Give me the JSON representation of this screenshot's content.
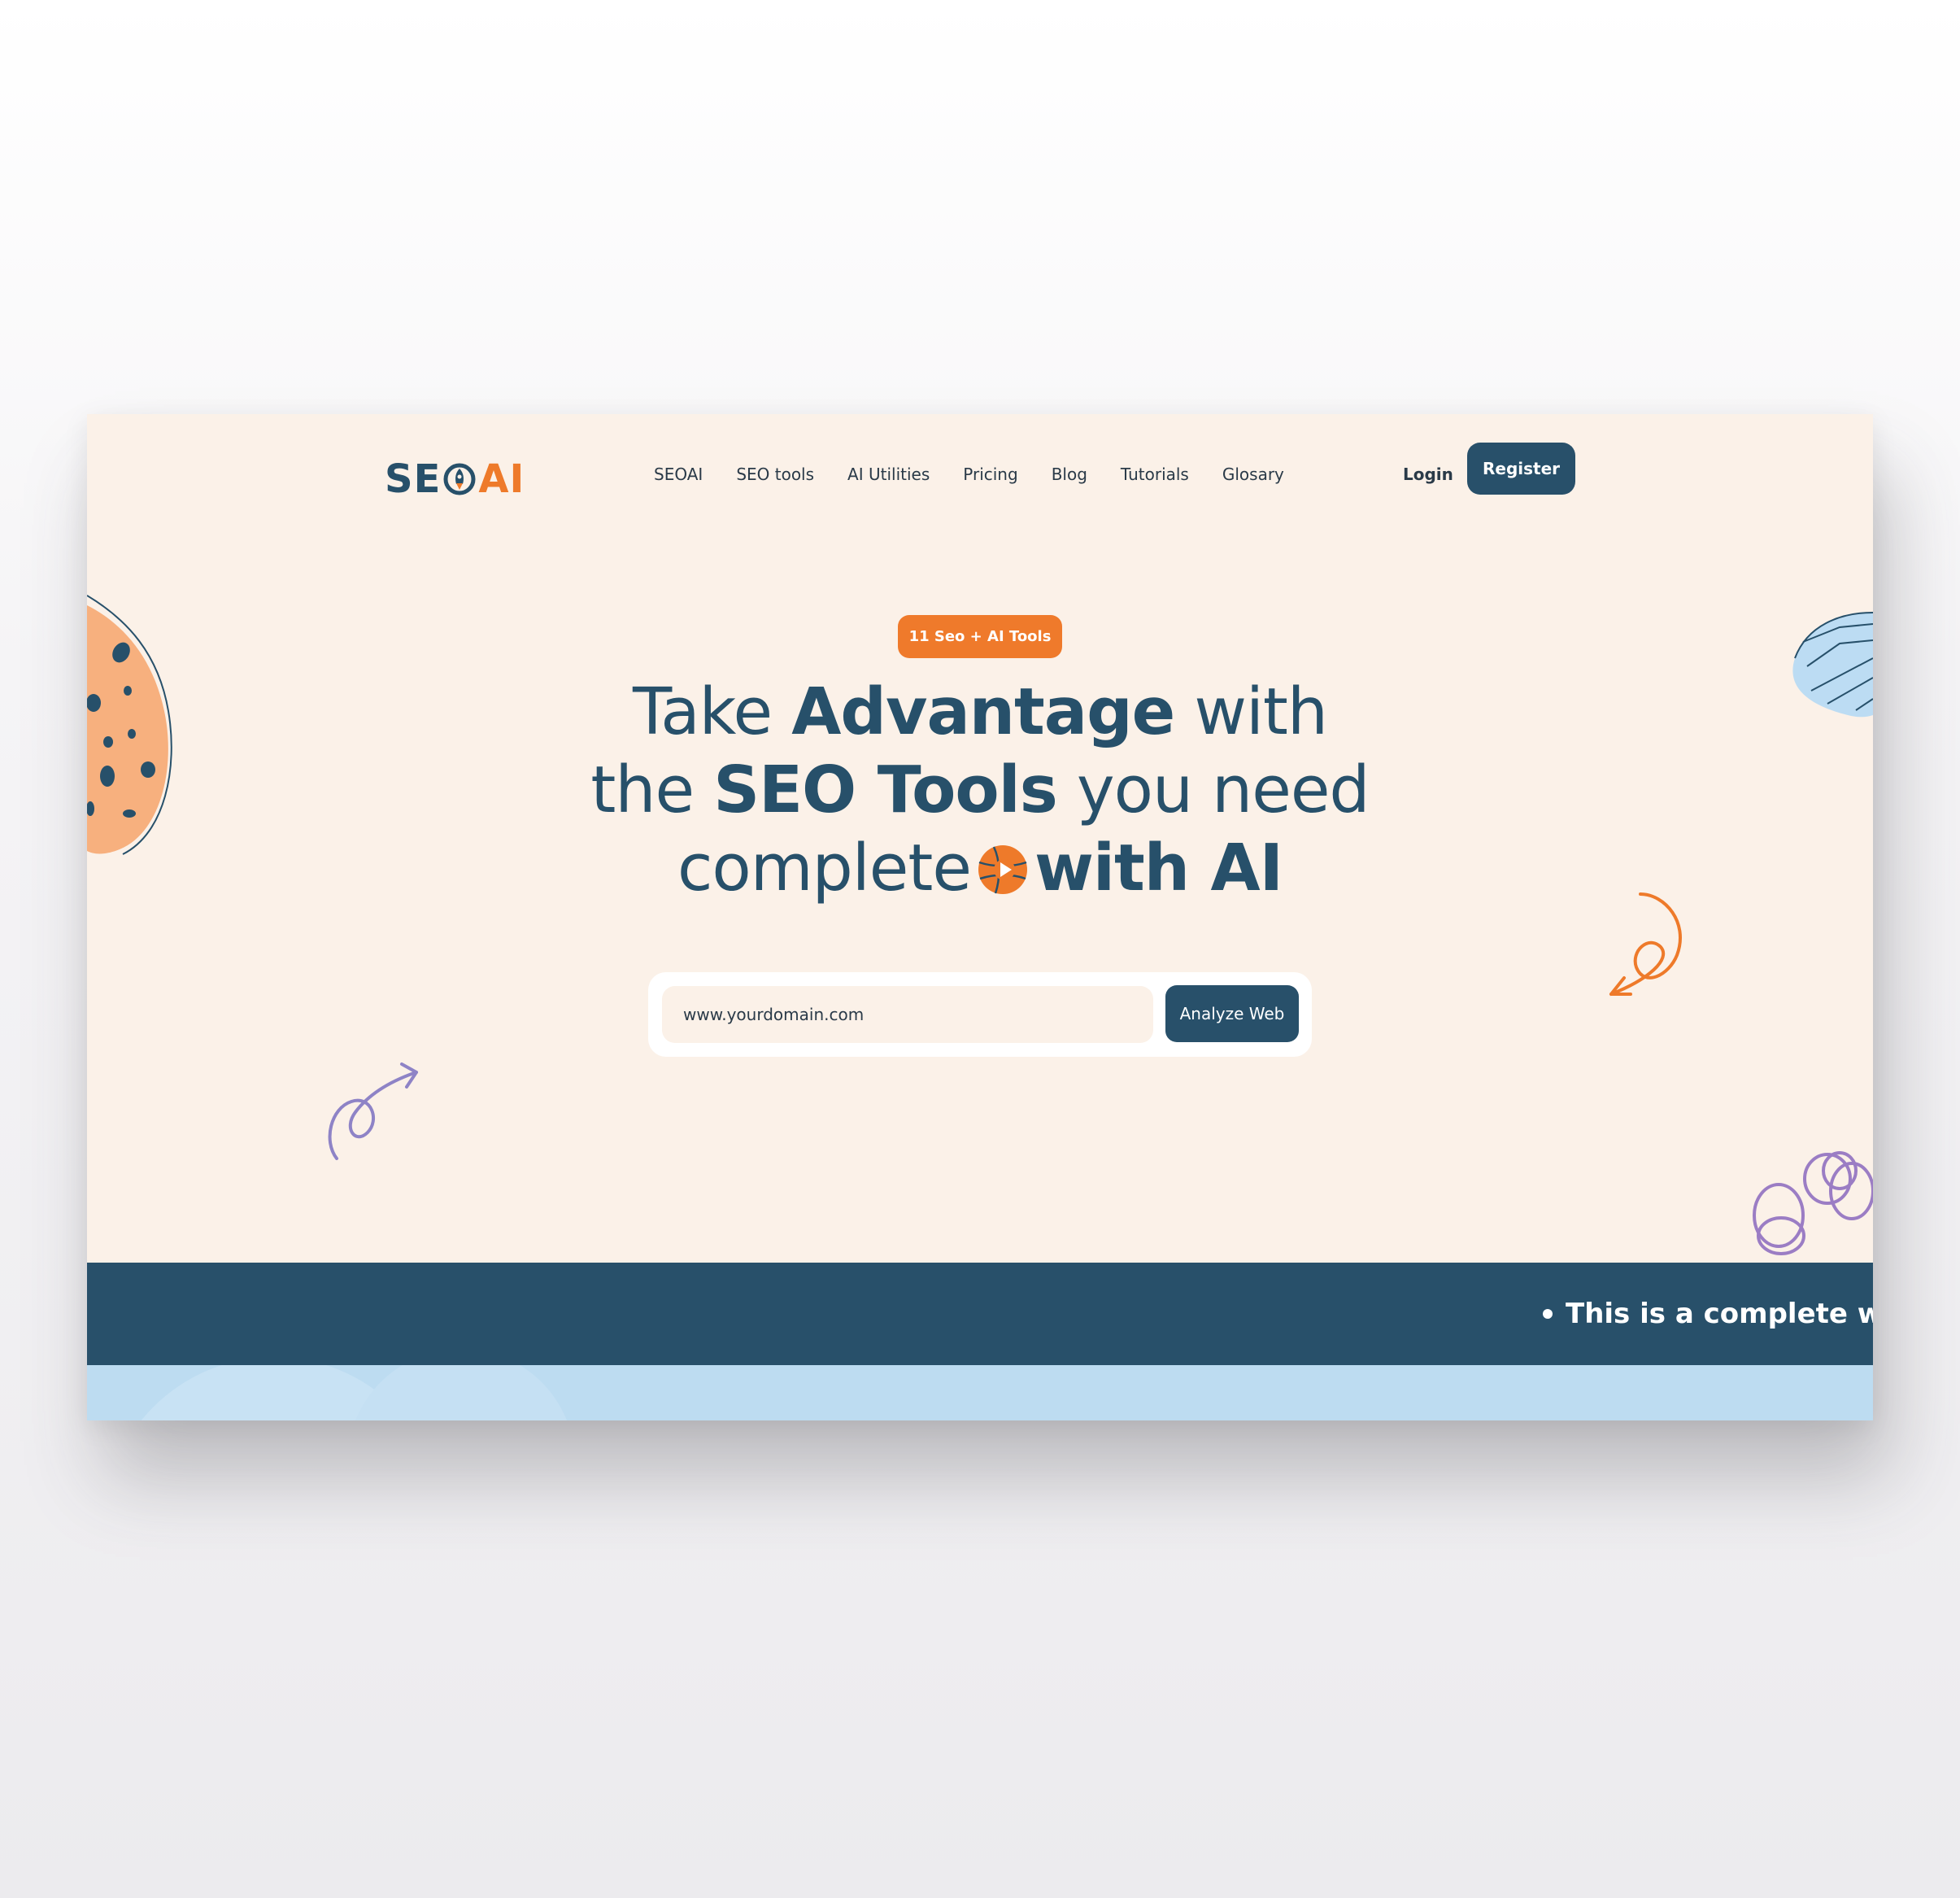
{
  "logo": {
    "left": "SE",
    "right": "AI"
  },
  "nav": {
    "items": [
      {
        "label": "SEOAI"
      },
      {
        "label": "SEO tools"
      },
      {
        "label": "AI Utilities"
      },
      {
        "label": "Pricing"
      },
      {
        "label": "Blog"
      },
      {
        "label": "Tutorials"
      },
      {
        "label": "Glosary"
      }
    ]
  },
  "auth": {
    "login_label": "Login",
    "register_label": "Register"
  },
  "hero": {
    "badge": "11 Seo + AI Tools",
    "line1_a": "Take ",
    "line1_b": "Advantage",
    "line1_c": " with",
    "line2_a": "the ",
    "line2_b": "SEO Tools",
    "line2_c": " you need",
    "line3_a": "complete",
    "line3_b": "with AI",
    "search_placeholder": "www.yourdomain.com",
    "analyze_label": "Analyze Web"
  },
  "ticker": {
    "text": "This is a complete web"
  },
  "colors": {
    "brand_navy": "#28506a",
    "brand_orange": "#ef7a2b",
    "hero_bg": "#fbf1e8",
    "bottom_band": "#bddcf1"
  },
  "icons": {
    "logo_mark": "rocket-pin-icon",
    "play": "play-icon"
  }
}
